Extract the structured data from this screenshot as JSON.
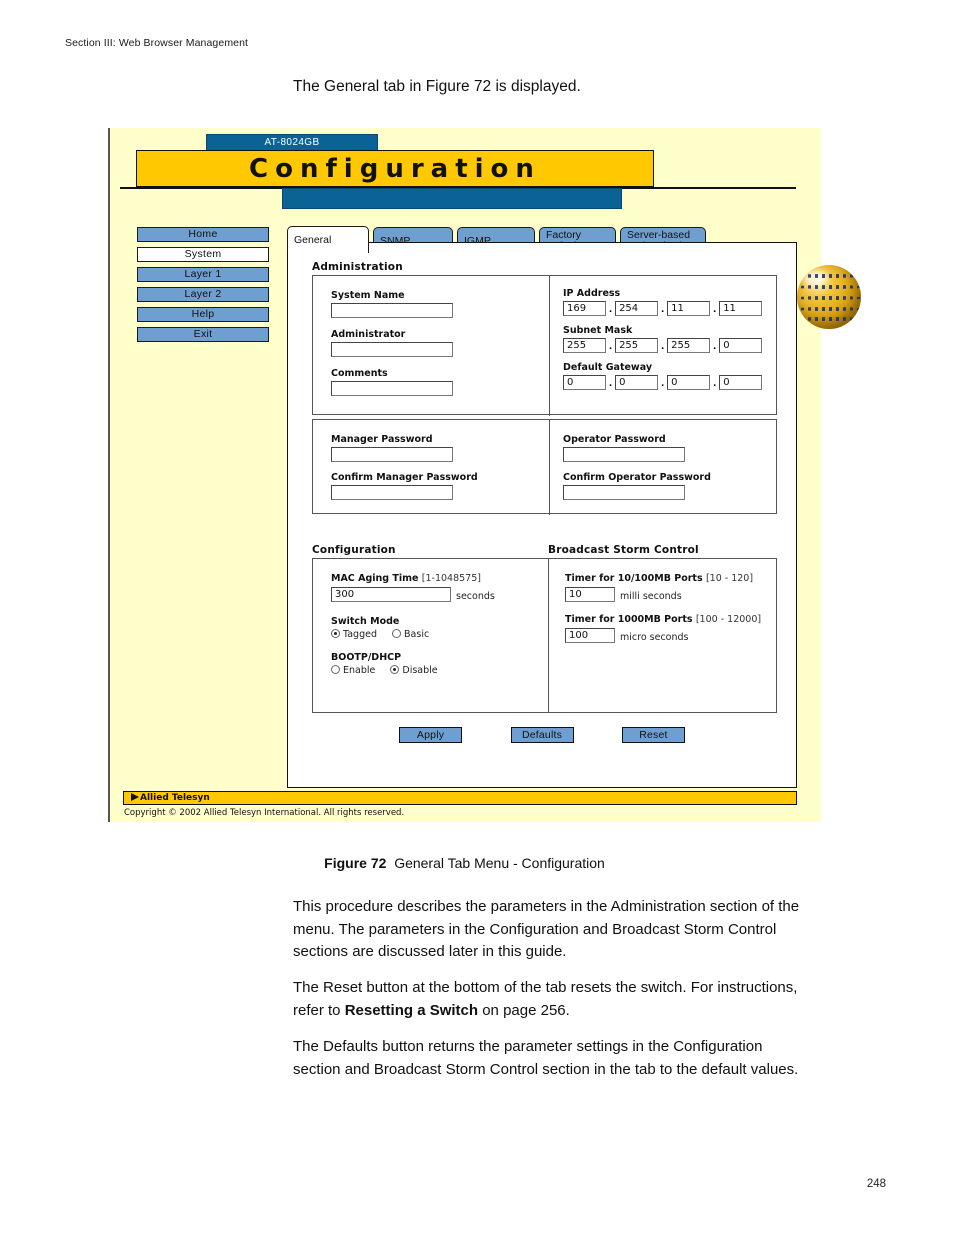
{
  "page": {
    "running_head": "Section III: Web Browser Management",
    "intro_line": "The General tab in Figure 72 is displayed.",
    "page_number": "248",
    "caption_label": "Figure 72",
    "caption_text": "General Tab Menu - Configuration",
    "para1": "This procedure describes the parameters in the Administration section of the menu. The parameters in the Configuration and Broadcast Storm Control sections are discussed later in this guide.",
    "para2_a": "The Reset button at the bottom of the tab resets the switch. For instructions, refer to ",
    "para2_b": "Resetting a Switch",
    "para2_c": " on page 256.",
    "para3": "The Defaults button returns the parameter settings in the Configuration section and Broadcast Storm Control section in the tab to the default values."
  },
  "colors": {
    "page_background": "#ffffcc",
    "banner_yellow": "#ffc800",
    "header_blue": "#0a6394",
    "button_blue": "#6f9fd0",
    "panel_white": "#ffffff"
  },
  "app": {
    "model_tab": "AT-8024GB",
    "title": "Configuration",
    "globe_icon": "globe-icon",
    "sidebar": {
      "items": [
        {
          "label": "Home",
          "active": false
        },
        {
          "label": "System",
          "active": true
        },
        {
          "label": "Layer 1",
          "active": false
        },
        {
          "label": "Layer 2",
          "active": false
        },
        {
          "label": "Help",
          "active": false
        },
        {
          "label": "Exit",
          "active": false
        }
      ]
    },
    "tabs": [
      {
        "label": "General",
        "active": true
      },
      {
        "label": "SNMP",
        "active": false
      },
      {
        "label": "IGMP",
        "active": false
      },
      {
        "label": "Factory\nDefault",
        "active": false
      },
      {
        "label": "Server-based\nAuthentication",
        "active": false
      }
    ],
    "administration": {
      "title": "Administration",
      "system_name": {
        "label": "System Name",
        "value": ""
      },
      "administrator": {
        "label": "Administrator",
        "value": ""
      },
      "comments": {
        "label": "Comments",
        "value": ""
      },
      "ip_address": {
        "label": "IP Address",
        "octets": [
          "169",
          "254",
          "11",
          "11"
        ]
      },
      "subnet_mask": {
        "label": "Subnet Mask",
        "octets": [
          "255",
          "255",
          "255",
          "0"
        ]
      },
      "default_gateway": {
        "label": "Default Gateway",
        "octets": [
          "0",
          "0",
          "0",
          "0"
        ]
      }
    },
    "passwords": {
      "manager": {
        "label": "Manager Password",
        "value": ""
      },
      "confirm_manager": {
        "label": "Confirm Manager Password",
        "value": ""
      },
      "operator": {
        "label": "Operator Password",
        "value": ""
      },
      "confirm_operator": {
        "label": "Confirm Operator Password",
        "value": ""
      }
    },
    "configuration": {
      "title": "Configuration",
      "mac_aging": {
        "label": "MAC Aging Time ",
        "range": "[1-1048575]",
        "value": "300",
        "unit": "seconds"
      },
      "switch_mode": {
        "label": "Switch Mode",
        "options": [
          {
            "label": "Tagged",
            "selected": true
          },
          {
            "label": "Basic",
            "selected": false
          }
        ]
      },
      "bootp_dhcp": {
        "label": "BOOTP/DHCP",
        "options": [
          {
            "label": "Enable",
            "selected": false
          },
          {
            "label": "Disable",
            "selected": true
          }
        ]
      }
    },
    "broadcast_storm_control": {
      "title": "Broadcast Storm Control",
      "timer_10_100": {
        "label": "Timer for 10/100MB Ports ",
        "range": "[10 - 120]",
        "value": "10",
        "unit": "milli seconds"
      },
      "timer_1000": {
        "label": "Timer for 1000MB Ports ",
        "range": "[100 - 12000]",
        "value": "100",
        "unit": "micro seconds"
      }
    },
    "actions": [
      {
        "label": "Apply"
      },
      {
        "label": "Defaults"
      },
      {
        "label": "Reset"
      }
    ],
    "footer": {
      "brand": "Allied Telesyn",
      "copyright": "Copyright © 2002 Allied Telesyn International. All rights reserved."
    }
  }
}
